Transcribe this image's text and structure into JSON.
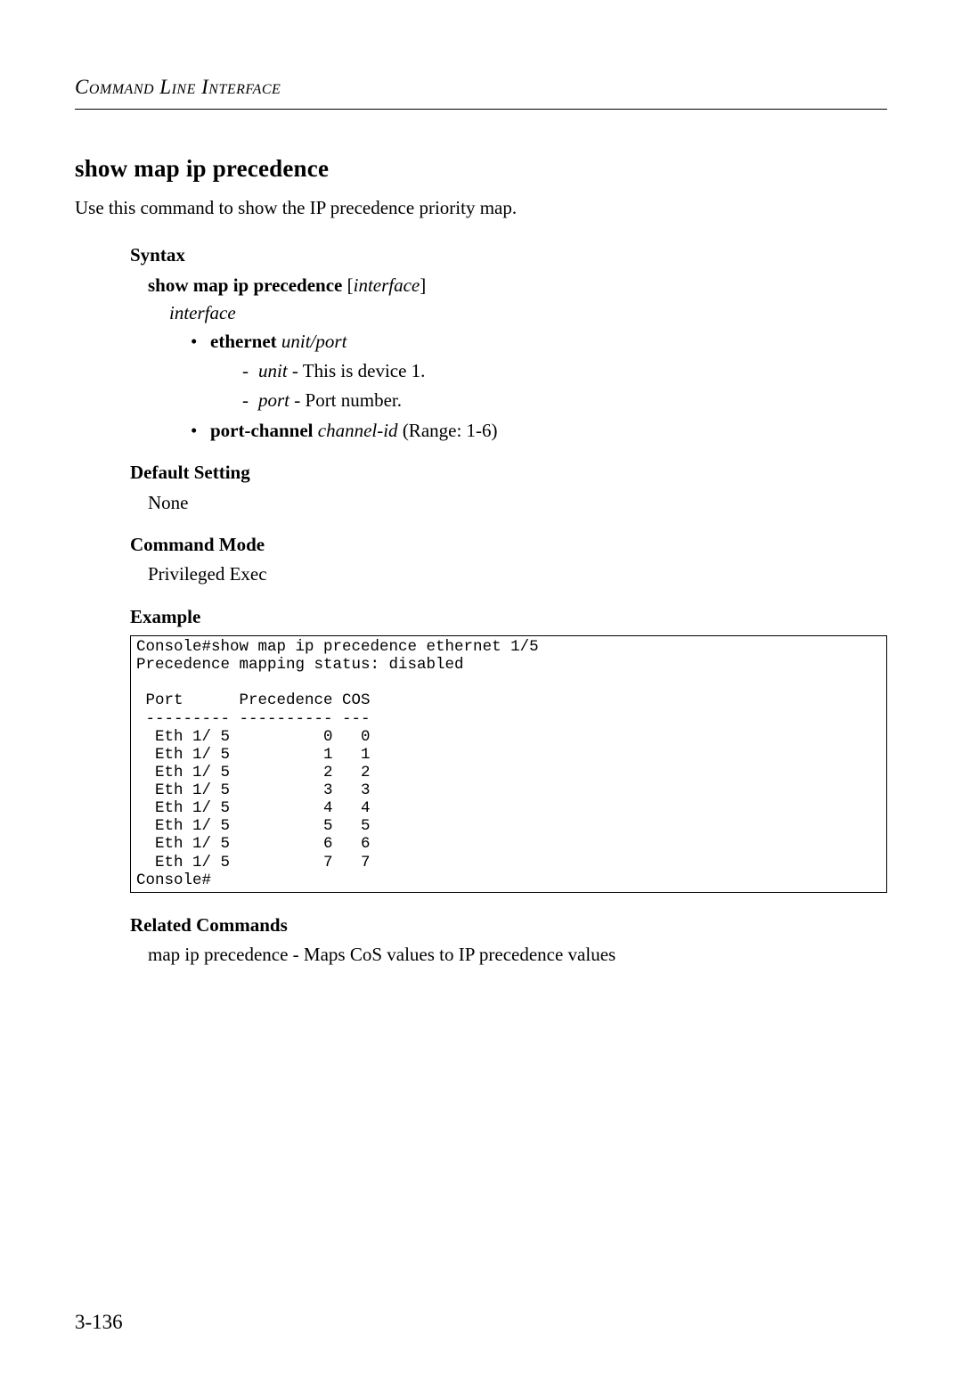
{
  "header": {
    "running_title": "Command Line Interface"
  },
  "command": {
    "title": "show map ip precedence",
    "intro": "Use this command to show the IP precedence priority map."
  },
  "sections": {
    "syntax_head": "Syntax",
    "syntax_cmd_bold": "show map ip precedence",
    "syntax_cmd_bracket_open": " [",
    "syntax_cmd_interface": "interface",
    "syntax_cmd_bracket_close": "]",
    "interface_word": "interface",
    "ethernet_label": "ethernet",
    "ethernet_args": "unit/port",
    "unit_label": "unit",
    "unit_desc": " - This is device 1.",
    "port_label": "port",
    "port_desc": " - Port number.",
    "portchannel_label": "port-channel",
    "portchannel_arg": "channel-id",
    "portchannel_range": " (Range: 1-6)",
    "default_head": "Default Setting",
    "default_value": "None",
    "mode_head": "Command Mode",
    "mode_value": "Privileged Exec",
    "example_head": "Example",
    "related_head": "Related Commands",
    "related_value": "map ip precedence - Maps CoS values to IP precedence values"
  },
  "example": {
    "code": "Console#show map ip precedence ethernet 1/5\nPrecedence mapping status: disabled\n\n Port      Precedence COS\n --------- ---------- ---\n  Eth 1/ 5          0   0\n  Eth 1/ 5          1   1\n  Eth 1/ 5          2   2\n  Eth 1/ 5          3   3\n  Eth 1/ 5          4   4\n  Eth 1/ 5          5   5\n  Eth 1/ 5          6   6\n  Eth 1/ 5          7   7\nConsole#"
  },
  "page_number": "3-136"
}
